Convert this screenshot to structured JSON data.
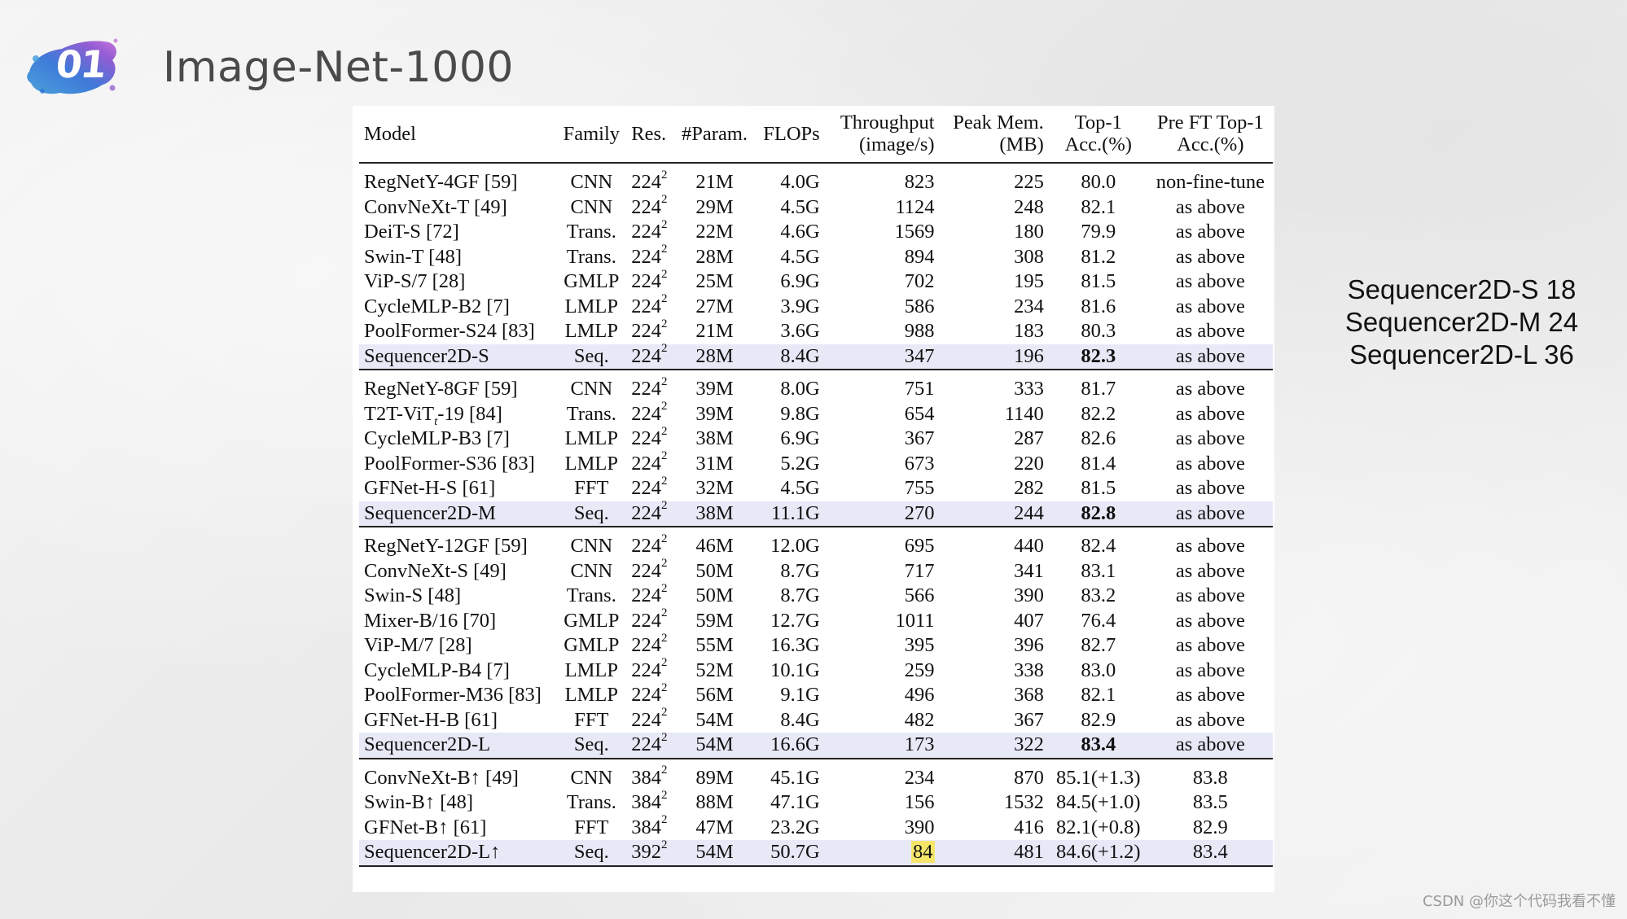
{
  "slide": {
    "number": "01",
    "title": "Image-Net-1000"
  },
  "table": {
    "headers": {
      "model": "Model",
      "family": "Family",
      "res": "Res.",
      "param": "#Param.",
      "flops": "FLOPs",
      "throughput": [
        "Throughput",
        "(image/s)"
      ],
      "mem": [
        "Peak Mem.",
        "(MB)"
      ],
      "top1": [
        "Top-1",
        "Acc.(%)"
      ],
      "preft": [
        "Pre FT Top-1",
        "Acc.(%)"
      ]
    },
    "groups": [
      [
        {
          "model": "RegNetY-4GF [59]",
          "family": "CNN",
          "res": "224",
          "param": "21M",
          "flops": "4.0G",
          "throughput": "823",
          "mem": "225",
          "top1": "80.0",
          "preft": "non-fine-tune"
        },
        {
          "model": "ConvNeXt-T [49]",
          "family": "CNN",
          "res": "224",
          "param": "29M",
          "flops": "4.5G",
          "throughput": "1124",
          "mem": "248",
          "top1": "82.1",
          "preft": "as above"
        },
        {
          "model": "DeiT-S [72]",
          "family": "Trans.",
          "res": "224",
          "param": "22M",
          "flops": "4.6G",
          "throughput": "1569",
          "mem": "180",
          "top1": "79.9",
          "preft": "as above"
        },
        {
          "model": "Swin-T [48]",
          "family": "Trans.",
          "res": "224",
          "param": "28M",
          "flops": "4.5G",
          "throughput": "894",
          "mem": "308",
          "top1": "81.2",
          "preft": "as above"
        },
        {
          "model": "ViP-S/7 [28]",
          "family": "GMLP",
          "res": "224",
          "param": "25M",
          "flops": "6.9G",
          "throughput": "702",
          "mem": "195",
          "top1": "81.5",
          "preft": "as above"
        },
        {
          "model": "CycleMLP-B2 [7]",
          "family": "LMLP",
          "res": "224",
          "param": "27M",
          "flops": "3.9G",
          "throughput": "586",
          "mem": "234",
          "top1": "81.6",
          "preft": "as above"
        },
        {
          "model": "PoolFormer-S24 [83]",
          "family": "LMLP",
          "res": "224",
          "param": "21M",
          "flops": "3.6G",
          "throughput": "988",
          "mem": "183",
          "top1": "80.3",
          "preft": "as above"
        },
        {
          "model": "Sequencer2D-S",
          "family": "Seq.",
          "res": "224",
          "param": "28M",
          "flops": "8.4G",
          "throughput": "347",
          "mem": "196",
          "top1": "82.3",
          "preft": "as above",
          "highlight": true
        }
      ],
      [
        {
          "model": "RegNetY-8GF [59]",
          "family": "CNN",
          "res": "224",
          "param": "39M",
          "flops": "8.0G",
          "throughput": "751",
          "mem": "333",
          "top1": "81.7",
          "preft": "as above"
        },
        {
          "model": "T2T-ViT",
          "model_sub": "t",
          "model_tail": "-19 [84]",
          "family": "Trans.",
          "res": "224",
          "param": "39M",
          "flops": "9.8G",
          "throughput": "654",
          "mem": "1140",
          "top1": "82.2",
          "preft": "as above"
        },
        {
          "model": "CycleMLP-B3 [7]",
          "family": "LMLP",
          "res": "224",
          "param": "38M",
          "flops": "6.9G",
          "throughput": "367",
          "mem": "287",
          "top1": "82.6",
          "preft": "as above"
        },
        {
          "model": "PoolFormer-S36 [83]",
          "family": "LMLP",
          "res": "224",
          "param": "31M",
          "flops": "5.2G",
          "throughput": "673",
          "mem": "220",
          "top1": "81.4",
          "preft": "as above"
        },
        {
          "model": "GFNet-H-S [61]",
          "family": "FFT",
          "res": "224",
          "param": "32M",
          "flops": "4.5G",
          "throughput": "755",
          "mem": "282",
          "top1": "81.5",
          "preft": "as above"
        },
        {
          "model": "Sequencer2D-M",
          "family": "Seq.",
          "res": "224",
          "param": "38M",
          "flops": "11.1G",
          "throughput": "270",
          "mem": "244",
          "top1": "82.8",
          "preft": "as above",
          "highlight": true
        }
      ],
      [
        {
          "model": "RegNetY-12GF  [59]",
          "family": "CNN",
          "res": "224",
          "param": "46M",
          "flops": "12.0G",
          "throughput": "695",
          "mem": "440",
          "top1": "82.4",
          "preft": "as above"
        },
        {
          "model": "ConvNeXt-S [49]",
          "family": "CNN",
          "res": "224",
          "param": "50M",
          "flops": "8.7G",
          "throughput": "717",
          "mem": "341",
          "top1": "83.1",
          "preft": "as above"
        },
        {
          "model": "Swin-S [48]",
          "family": "Trans.",
          "res": "224",
          "param": "50M",
          "flops": "8.7G",
          "throughput": "566",
          "mem": "390",
          "top1": "83.2",
          "preft": "as above"
        },
        {
          "model": "Mixer-B/16 [70]",
          "family": "GMLP",
          "res": "224",
          "param": "59M",
          "flops": "12.7G",
          "throughput": "1011",
          "mem": "407",
          "top1": "76.4",
          "preft": "as above"
        },
        {
          "model": "ViP-M/7 [28]",
          "family": "GMLP",
          "res": "224",
          "param": "55M",
          "flops": "16.3G",
          "throughput": "395",
          "mem": "396",
          "top1": "82.7",
          "preft": "as above"
        },
        {
          "model": "CycleMLP-B4 [7]",
          "family": "LMLP",
          "res": "224",
          "param": "52M",
          "flops": "10.1G",
          "throughput": "259",
          "mem": "338",
          "top1": "83.0",
          "preft": "as above"
        },
        {
          "model": "PoolFormer-M36 [83]",
          "family": "LMLP",
          "res": "224",
          "param": "56M",
          "flops": "9.1G",
          "throughput": "496",
          "mem": "368",
          "top1": "82.1",
          "preft": "as above"
        },
        {
          "model": "GFNet-H-B [61]",
          "family": "FFT",
          "res": "224",
          "param": "54M",
          "flops": "8.4G",
          "throughput": "482",
          "mem": "367",
          "top1": "82.9",
          "preft": "as above"
        },
        {
          "model": "Sequencer2D-L",
          "family": "Seq.",
          "res": "224",
          "param": "54M",
          "flops": "16.6G",
          "throughput": "173",
          "mem": "322",
          "top1": "83.4",
          "preft": "as above",
          "highlight": true
        }
      ],
      [
        {
          "model": "ConvNeXt-B↑ [49]",
          "family": "CNN",
          "res": "384",
          "param": "89M",
          "flops": "45.1G",
          "throughput": "234",
          "mem": "870",
          "top1": "85.1(+1.3)",
          "preft": "83.8"
        },
        {
          "model": "Swin-B↑ [48]",
          "family": "Trans.",
          "res": "384",
          "param": "88M",
          "flops": "47.1G",
          "throughput": "156",
          "mem": "1532",
          "top1": "84.5(+1.0)",
          "preft": "83.5"
        },
        {
          "model": "GFNet-B↑ [61]",
          "family": "FFT",
          "res": "384",
          "param": "47M",
          "flops": "23.2G",
          "throughput": "390",
          "mem": "416",
          "top1": "82.1(+0.8)",
          "preft": "82.9"
        },
        {
          "model": "Sequencer2D-L↑",
          "family": "Seq.",
          "res": "392",
          "param": "54M",
          "flops": "50.7G",
          "throughput": "84",
          "mem": "481",
          "top1": "84.6(+1.2)",
          "preft": "83.4",
          "highlight": true,
          "throughput_marked": true,
          "bold_top1": false
        }
      ]
    ],
    "res_exponent": "2"
  },
  "side_notes": [
    "Sequencer2D-S 18",
    "Sequencer2D-M 24",
    "Sequencer2D-L 36"
  ],
  "watermark": "CSDN @你这个代码我看不懂",
  "colors": {
    "seq_row": "#e7e9f7",
    "highlight_marker": "#f5e66a",
    "badge_blue": "#2f6fd6",
    "badge_purple": "#8a4fd0"
  }
}
